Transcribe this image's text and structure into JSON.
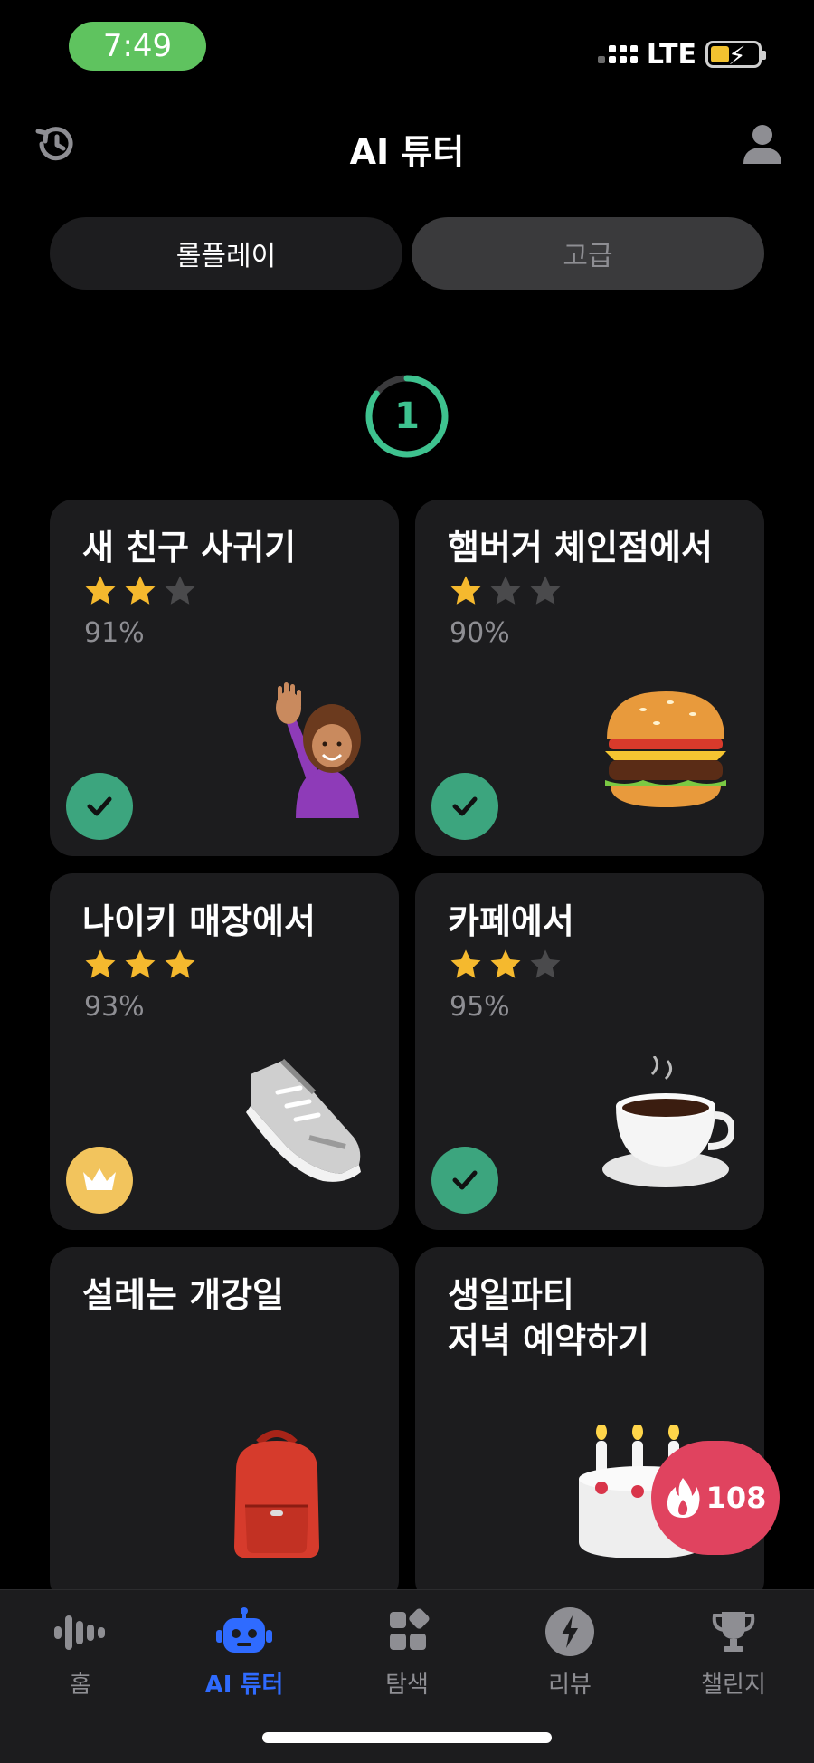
{
  "status": {
    "time": "7:49",
    "network": "LTE"
  },
  "header": {
    "title": "AI 튜터"
  },
  "segments": [
    {
      "label": "롤플레이",
      "active": true
    },
    {
      "label": "고급",
      "active": false
    }
  ],
  "level": {
    "number": "1",
    "progress_fraction": 0.85
  },
  "cards": [
    {
      "title": "새 친구 사귀기",
      "stars": 2,
      "percent": "91%",
      "status": "completed",
      "emoji": "waving-person"
    },
    {
      "title": "햄버거 체인점에서",
      "stars": 1,
      "percent": "90%",
      "status": "completed",
      "emoji": "hamburger"
    },
    {
      "title": "나이키 매장에서",
      "stars": 3,
      "percent": "93%",
      "status": "crown",
      "emoji": "sneaker"
    },
    {
      "title": "카페에서",
      "stars": 2,
      "percent": "95%",
      "status": "completed",
      "emoji": "coffee"
    },
    {
      "title": "설레는 개강일",
      "stars": 0,
      "percent": "",
      "status": "none",
      "emoji": "backpack"
    },
    {
      "title": "생일파티\n저녁 예약하기",
      "stars": 0,
      "percent": "",
      "status": "none",
      "emoji": "birthday-cake"
    }
  ],
  "streak": {
    "count": "108"
  },
  "tabs": [
    {
      "label": "홈",
      "icon": "voice-wave-icon",
      "active": false
    },
    {
      "label": "AI 튜터",
      "icon": "robot-icon",
      "active": true
    },
    {
      "label": "탐색",
      "icon": "grid-explore-icon",
      "active": false
    },
    {
      "label": "리뷰",
      "icon": "lightning-icon",
      "active": false
    },
    {
      "label": "챌린지",
      "icon": "trophy-icon",
      "active": false
    }
  ],
  "colors": {
    "accent_green": "#3ca57e",
    "tab_active": "#2f6bff",
    "star_gold": "#f5b92e",
    "streak": "#e0435f"
  }
}
